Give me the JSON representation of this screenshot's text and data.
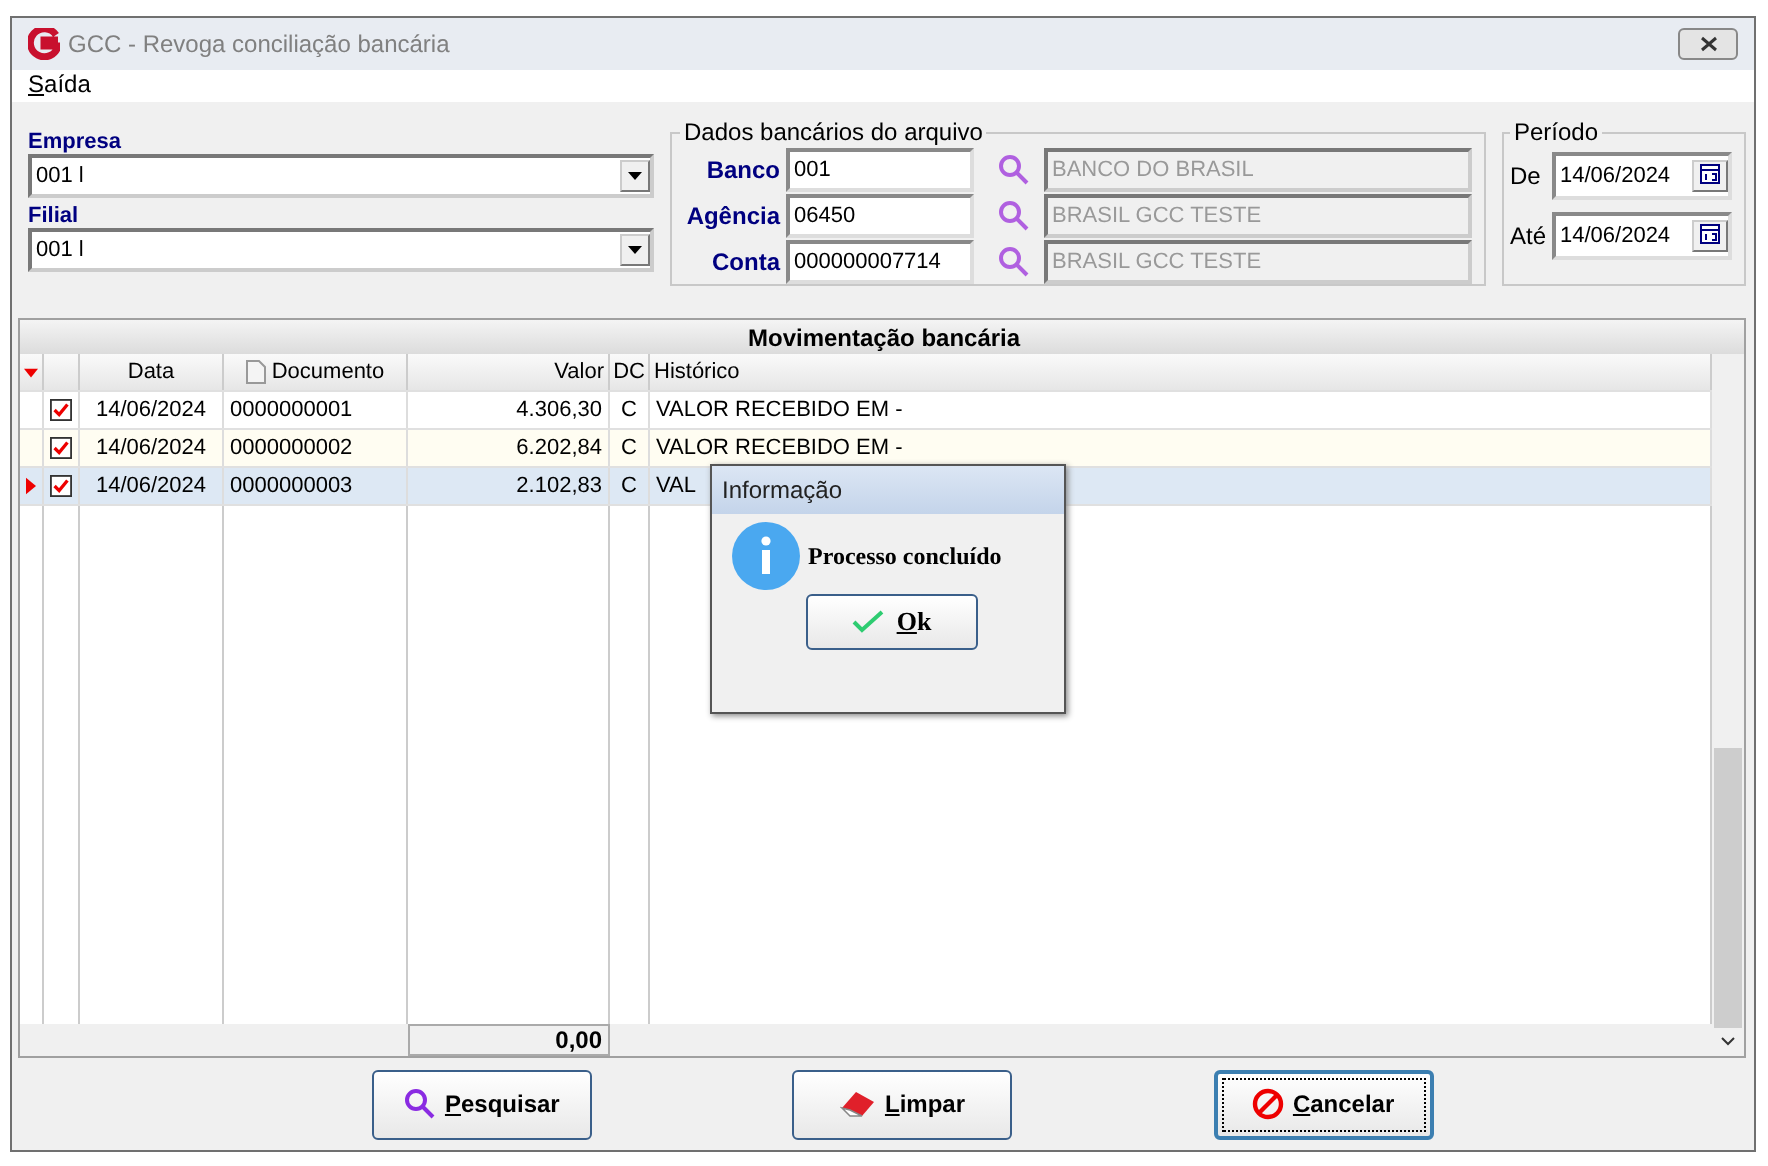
{
  "window": {
    "title": "GCC - Revoga conciliação bancária"
  },
  "menu": [
    {
      "label": "Saída"
    }
  ],
  "empresa": {
    "label": "Empresa",
    "value": "001 l"
  },
  "filial": {
    "label": "Filial",
    "value": "001 l"
  },
  "bank": {
    "title": "Dados bancários do arquivo",
    "rows": [
      {
        "label": "Banco",
        "code": "001",
        "name": "BANCO DO BRASIL"
      },
      {
        "label": "Agência",
        "code": "06450",
        "name": "BRASIL GCC TESTE"
      },
      {
        "label": "Conta",
        "code": "000000007714",
        "name": "BRASIL GCC TESTE"
      }
    ]
  },
  "period": {
    "title": "Período",
    "from": {
      "label": "De",
      "value": "14/06/2024"
    },
    "to": {
      "label": "Até",
      "value": "14/06/2024"
    }
  },
  "grid": {
    "title": "Movimentação bancária",
    "columns": [
      "Data",
      "Documento",
      "Valor",
      "DC",
      "Histórico"
    ],
    "rows": [
      {
        "checked": true,
        "selected": false,
        "date": "14/06/2024",
        "doc": "0000000001",
        "value": "4.306,30",
        "dc": "C",
        "hist": "VALOR RECEBIDO EM -"
      },
      {
        "checked": true,
        "selected": false,
        "date": "14/06/2024",
        "doc": "0000000002",
        "value": "6.202,84",
        "dc": "C",
        "hist": "VALOR RECEBIDO EM -"
      },
      {
        "checked": true,
        "selected": true,
        "date": "14/06/2024",
        "doc": "0000000003",
        "value": "2.102,83",
        "dc": "C",
        "hist": "VAL"
      }
    ],
    "total": "0,00"
  },
  "dialog": {
    "title": "Informação",
    "message": "Processo concluído",
    "button": "Ok"
  },
  "buttons": [
    {
      "label": "Pesquisar",
      "kind": "search",
      "focused": false
    },
    {
      "label": "Limpar",
      "kind": "clear",
      "focused": false
    },
    {
      "label": "Cancelar",
      "kind": "cancel",
      "focused": true
    }
  ]
}
